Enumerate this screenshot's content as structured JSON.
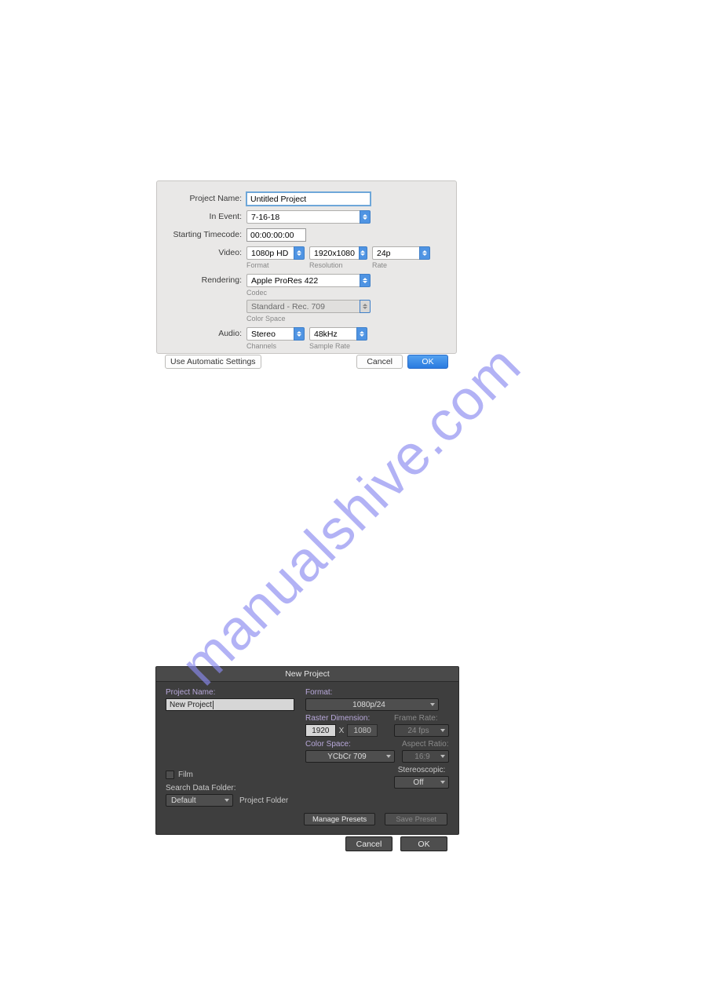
{
  "watermark": "manualshive.com",
  "dialog1": {
    "project_name_label": "Project Name:",
    "project_name_value": "Untitled Project",
    "in_event_label": "In Event:",
    "in_event_value": "7-16-18",
    "starting_timecode_label": "Starting Timecode:",
    "starting_timecode_value": "00:00:00:00",
    "video_label": "Video:",
    "video_format_value": "1080p HD",
    "video_format_sublabel": "Format",
    "video_resolution_value": "1920x1080",
    "video_resolution_sublabel": "Resolution",
    "video_rate_value": "24p",
    "video_rate_sublabel": "Rate",
    "rendering_label": "Rendering:",
    "rendering_codec_value": "Apple ProRes 422",
    "rendering_codec_sublabel": "Codec",
    "rendering_color_space_value": "Standard - Rec. 709",
    "rendering_color_space_sublabel": "Color Space",
    "audio_label": "Audio:",
    "audio_channels_value": "Stereo",
    "audio_channels_sublabel": "Channels",
    "audio_sample_rate_value": "48kHz",
    "audio_sample_rate_sublabel": "Sample Rate",
    "auto_settings_label": "Use Automatic Settings",
    "cancel_label": "Cancel",
    "ok_label": "OK"
  },
  "dialog2": {
    "title": "New Project",
    "project_name_label": "Project Name:",
    "project_name_value": "New Project",
    "film_label": "Film",
    "search_data_folder_label": "Search Data Folder:",
    "search_data_folder_value": "Default",
    "project_folder_label": "Project Folder",
    "format_label": "Format:",
    "format_value": "1080p/24",
    "raster_label": "Raster Dimension:",
    "raster_w": "1920",
    "raster_x": "X",
    "raster_h": "1080",
    "frame_rate_label": "Frame Rate:",
    "frame_rate_value": "24 fps",
    "color_space_label": "Color Space:",
    "color_space_value": "YCbCr 709",
    "aspect_ratio_label": "Aspect Ratio:",
    "aspect_ratio_value": "16:9",
    "stereoscopic_label": "Stereoscopic:",
    "stereoscopic_value": "Off",
    "manage_presets_label": "Manage Presets",
    "save_preset_label": "Save Preset",
    "cancel_label": "Cancel",
    "ok_label": "OK"
  }
}
